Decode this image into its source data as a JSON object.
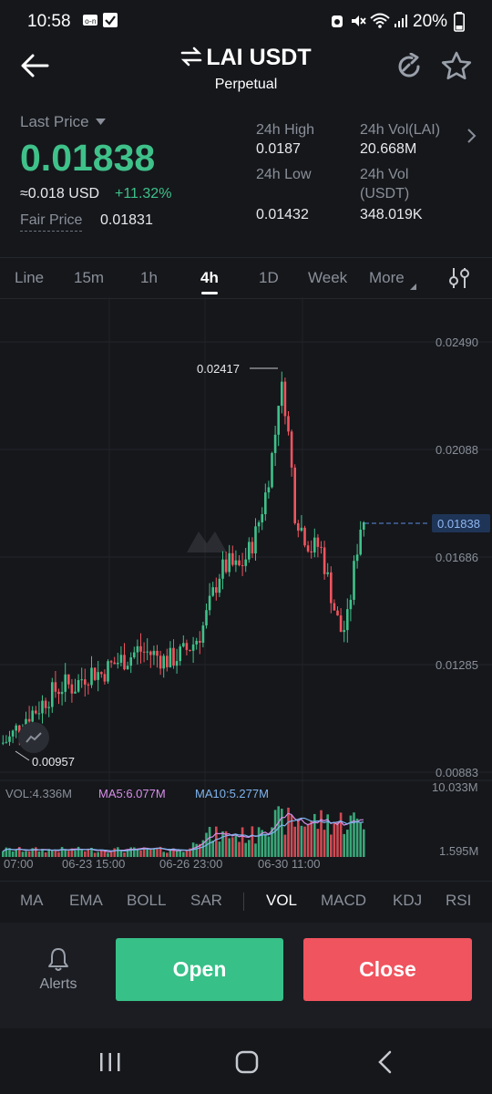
{
  "status": {
    "time": "10:58",
    "battery": "20%"
  },
  "header": {
    "title": "LAI USDT",
    "subtitle": "Perpetual"
  },
  "price": {
    "last_price_label": "Last Price",
    "last_price": "0.01838",
    "usd_value": "≈0.018 USD",
    "change": "+11.32%",
    "fair_price_label": "Fair Price",
    "fair_price": "0.01831"
  },
  "stats": {
    "high_label": "24h High",
    "high_value": "0.0187",
    "vol_lai_label": "24h Vol(LAI)",
    "vol_lai_value": "20.668M",
    "low_label": "24h Low",
    "low_value": "0.01432",
    "vol_usdt_label_1": "24h Vol",
    "vol_usdt_label_2": "(USDT)",
    "vol_usdt_value": "348.019K"
  },
  "tabs": [
    "Line",
    "15m",
    "1h",
    "4h",
    "1D",
    "Week",
    "More"
  ],
  "active_tab": "4h",
  "chart_data": {
    "type": "candlestick",
    "y_ticks": [
      "0.02490",
      "0.02088",
      "0.01686",
      "0.01285",
      "0.00883"
    ],
    "current_price_label": "0.01838",
    "high_annotation": "0.02417",
    "low_annotation": "0.00957",
    "x_ticks": [
      "07:00",
      "06-23 15:00",
      "06-26 23:00",
      "06-30 11:00"
    ],
    "volume": {
      "vol_label": "VOL:4.336M",
      "ma5_label": "MA5:6.077M",
      "ma10_label": "MA10:5.277M",
      "top_label": "10.033M",
      "bottom_label": "1.595M"
    },
    "colors": {
      "up": "#3fc18a",
      "down": "#f0545e",
      "ma5": "#d78ee8",
      "ma10": "#7fb4ee"
    }
  },
  "indicators": [
    "MA",
    "EMA",
    "BOLL",
    "SAR",
    "VOL",
    "MACD",
    "KDJ",
    "RSI"
  ],
  "active_indicator": "VOL",
  "actions": {
    "alerts_label": "Alerts",
    "open_label": "Open",
    "close_label": "Close"
  },
  "colors": {
    "open_btn": "#37c088",
    "close_btn": "#f0545e",
    "accent": "#3fc18a"
  }
}
